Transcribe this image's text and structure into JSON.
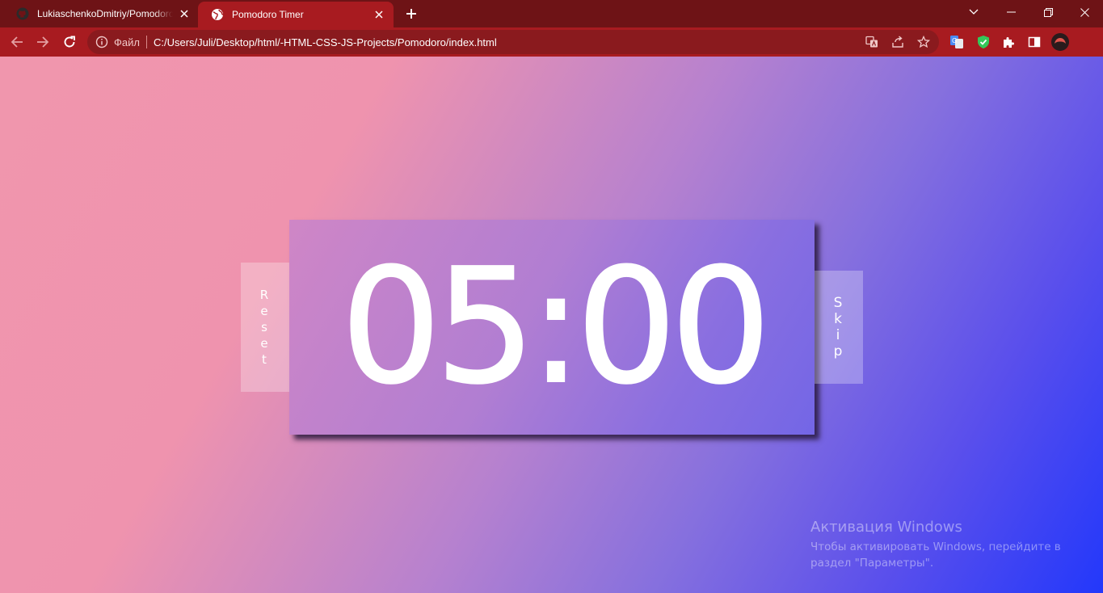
{
  "browser": {
    "tabs": [
      {
        "title": "LukiaschenkoDmitriy/Pomodoro-",
        "icon": "github-icon",
        "active": false
      },
      {
        "title": "Pomodoro Timer",
        "icon": "globe-icon",
        "active": true
      }
    ],
    "address": {
      "file_label": "Файл",
      "url": "C:/Users/Juli/Desktop/html/-HTML-CSS-JS-Projects/Pomodoro/index.html"
    }
  },
  "timer": {
    "time": "05:00"
  },
  "buttons": {
    "reset_letters": [
      "R",
      "e",
      "s",
      "e",
      "t"
    ],
    "skip_letters": [
      "S",
      "k",
      "i",
      "p"
    ]
  },
  "watermark": {
    "title": "Активация Windows",
    "line1": "Чтобы активировать Windows, перейдите в",
    "line2": "раздел \"Параметры\"."
  },
  "colors": {
    "tabstrip": "#6e1316",
    "toolbar": "#a81b20",
    "gradient_start": "#f096ad",
    "gradient_end": "#2338fb"
  }
}
